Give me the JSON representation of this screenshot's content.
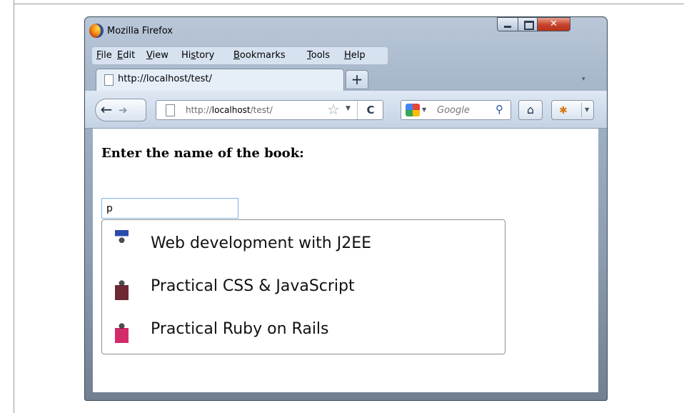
{
  "window": {
    "title": "Mozilla Firefox",
    "controls": {
      "minimize": "–",
      "maximize": "□",
      "close": "✕"
    }
  },
  "menubar": {
    "items": [
      {
        "key": "F",
        "rest": "ile"
      },
      {
        "key": "E",
        "rest": "dit"
      },
      {
        "key": "V",
        "rest": "iew"
      },
      {
        "pre": "Hi",
        "key": "s",
        "rest": "tory"
      },
      {
        "key": "B",
        "rest": "ookmarks"
      },
      {
        "key": "T",
        "rest": "ools"
      },
      {
        "key": "H",
        "rest": "elp"
      }
    ]
  },
  "tab": {
    "label": "http://localhost/test/",
    "new_tab": "+"
  },
  "nav": {
    "back": "←",
    "forward": "➜",
    "url_prefix": "http://",
    "url_host": "localhost",
    "url_path": "/test/",
    "star_icon": "☆",
    "reload": "C",
    "search_placeholder": "Google",
    "search_icon": "⚲",
    "home_icon": "⌂",
    "addon_icon": "✱"
  },
  "page": {
    "heading": "Enter the name of the book:",
    "input_value": "p",
    "suggestions": [
      {
        "label": "Web development with J2EE",
        "icon": "book-cover-j2ee-icon"
      },
      {
        "label": "Practical CSS & JavaScript",
        "icon": "book-cover-css-icon"
      },
      {
        "label": "Practical Ruby on Rails",
        "icon": "book-cover-ruby-icon"
      }
    ]
  },
  "colors": {
    "input_border": "#7eb4ea",
    "window_chrome": "#9fb1c6",
    "close_button": "#c7412a"
  }
}
